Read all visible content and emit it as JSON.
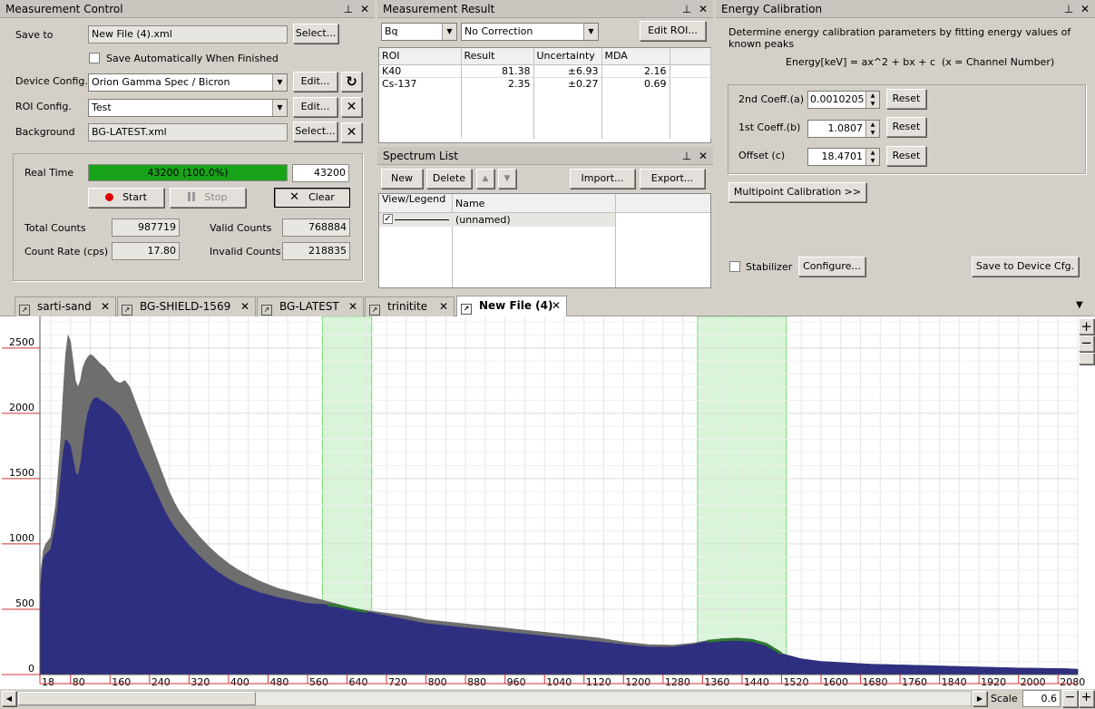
{
  "measurement_control": {
    "title": "Measurement Control",
    "save_to_label": "Save to",
    "save_to_value": "New File (4).xml",
    "select_label": "Select...",
    "auto_save_label": "Save Automatically When Finished",
    "device_config_label": "Device Config.",
    "device_config_value": "Orion Gamma Spec / Bicron",
    "edit_label": "Edit...",
    "roi_config_label": "ROI Config.",
    "roi_config_value": "Test",
    "background_label": "Background",
    "background_value": "BG-LATEST.xml",
    "real_time_label": "Real Time",
    "real_time_progress_text": "43200 (100.0%)",
    "real_time_progress": 1.0,
    "real_time_value": "43200",
    "start_label": "Start",
    "stop_label": "Stop",
    "clear_label": "Clear",
    "total_counts_label": "Total Counts",
    "total_counts_value": "987719",
    "valid_counts_label": "Valid Counts",
    "valid_counts_value": "768884",
    "count_rate_label": "Count Rate (cps)",
    "count_rate_value": "17.80",
    "invalid_counts_label": "Invalid Counts",
    "invalid_counts_value": "218835"
  },
  "measurement_result": {
    "title": "Measurement Result",
    "unit_value": "Bq",
    "correction_value": "No Correction",
    "edit_roi_label": "Edit ROI...",
    "columns": [
      "ROI",
      "Result",
      "Uncertainty",
      "MDA"
    ],
    "rows": [
      {
        "roi": "K40",
        "result": "81.38",
        "uncertainty": "±6.93",
        "mda": "2.16"
      },
      {
        "roi": "Cs-137",
        "result": "2.35",
        "uncertainty": "±0.27",
        "mda": "0.69"
      }
    ]
  },
  "spectrum_list": {
    "title": "Spectrum List",
    "new_label": "New",
    "delete_label": "Delete",
    "import_label": "Import...",
    "export_label": "Export...",
    "col_view": "View/Legend",
    "col_name": "Name",
    "row_name": "(unnamed)"
  },
  "energy_calibration": {
    "title": "Energy Calibration",
    "description": "Determine energy calibration parameters by fitting energy values of known peaks",
    "formula": "Energy[keV] = ax^2 + bx + c  (x = Channel Number)",
    "coeff_a_label": "2nd Coeff.(a)",
    "coeff_a_value": "0.0010205",
    "coeff_b_label": "1st Coeff.(b)",
    "coeff_b_value": "1.0807",
    "coeff_c_label": "Offset (c)",
    "coeff_c_value": "18.4701",
    "reset_label": "Reset",
    "multipoint_label": "Multipoint Calibration >>",
    "stabilizer_label": "Stabilizer",
    "configure_label": "Configure...",
    "save_device_label": "Save to Device Cfg."
  },
  "tabs": [
    {
      "label": "sarti-sand",
      "active": false
    },
    {
      "label": "BG-SHIELD-1569",
      "active": false
    },
    {
      "label": "BG-LATEST",
      "active": false
    },
    {
      "label": "trinitite",
      "active": false
    },
    {
      "label": "New File (4)",
      "active": true
    }
  ],
  "bottom_bar": {
    "scale_label": "Scale",
    "scale_value": "0.6"
  },
  "colors": {
    "spectrum_fill": "#2e2f80",
    "background_fill": "#6e6e6e",
    "roi_band": "#d8f5d8",
    "progress_green": "#19a319"
  },
  "chart_data": {
    "type": "area",
    "x_ticks": [
      "18",
      "80",
      "160",
      "240",
      "320",
      "400",
      "480",
      "560",
      "640",
      "720",
      "800",
      "880",
      "960",
      "1040",
      "1120",
      "1200",
      "1280",
      "1360",
      "1440",
      "1520",
      "1600",
      "1680",
      "1760",
      "1840",
      "1920",
      "2000",
      "2080"
    ],
    "y_ticks": [
      "0",
      "500",
      "1000",
      "1500",
      "2000",
      "2500"
    ],
    "ylim": [
      0,
      2700
    ],
    "xlim": [
      0,
      2120
    ],
    "roi_ranges": [
      [
        590,
        690
      ],
      [
        1350,
        1530
      ]
    ],
    "series": [
      {
        "x": [
          18,
          20,
          25,
          30,
          40,
          50,
          60,
          65,
          70,
          75,
          80,
          85,
          90,
          95,
          100,
          105,
          110,
          115,
          120,
          125,
          130,
          135,
          140,
          150,
          160,
          170,
          180,
          190,
          200,
          210,
          220,
          230,
          240,
          250,
          260,
          270,
          280,
          290,
          300,
          320,
          340,
          360,
          380,
          400,
          420,
          440,
          460,
          480,
          500,
          520,
          540,
          560,
          580,
          600,
          620,
          640,
          660,
          680,
          700,
          720,
          760,
          800,
          850,
          900,
          950,
          1000,
          1050,
          1100,
          1150,
          1200,
          1250,
          1300,
          1340,
          1370,
          1400,
          1430,
          1460,
          1490,
          1520,
          1560,
          1600,
          1650,
          1700,
          1800,
          1900,
          2000,
          2100,
          2120
        ],
        "values": [
          0,
          800,
          950,
          1000,
          1050,
          1300,
          1800,
          2150,
          2450,
          2600,
          2550,
          2400,
          2250,
          2200,
          2250,
          2350,
          2400,
          2430,
          2450,
          2440,
          2420,
          2400,
          2380,
          2350,
          2300,
          2250,
          2230,
          2250,
          2200,
          2100,
          2000,
          1900,
          1800,
          1700,
          1600,
          1500,
          1400,
          1320,
          1250,
          1150,
          1060,
          980,
          910,
          850,
          800,
          760,
          720,
          690,
          660,
          640,
          620,
          600,
          580,
          560,
          540,
          520,
          500,
          490,
          480,
          470,
          450,
          420,
          400,
          380,
          360,
          340,
          320,
          300,
          280,
          250,
          230,
          225,
          240,
          260,
          275,
          280,
          270,
          240,
          160,
          120,
          100,
          90,
          80,
          70,
          60,
          50,
          45,
          40
        ]
      },
      {
        "x": [
          18,
          20,
          25,
          30,
          40,
          50,
          60,
          65,
          70,
          75,
          80,
          85,
          90,
          95,
          100,
          105,
          110,
          115,
          120,
          125,
          130,
          135,
          140,
          150,
          160,
          170,
          180,
          190,
          200,
          210,
          220,
          230,
          240,
          250,
          260,
          270,
          280,
          290,
          300,
          320,
          340,
          360,
          380,
          400,
          420,
          440,
          460,
          480,
          500,
          520,
          540,
          560,
          580,
          600,
          620,
          640,
          660,
          680,
          700,
          720,
          760,
          800,
          850,
          900,
          950,
          1000,
          1050,
          1100,
          1150,
          1200,
          1250,
          1300,
          1340,
          1370,
          1400,
          1430,
          1460,
          1490,
          1520,
          1560,
          1600,
          1650,
          1700,
          1800,
          1900,
          2000,
          2100,
          2120
        ],
        "values": [
          0,
          700,
          880,
          920,
          960,
          1150,
          1500,
          1700,
          1800,
          1780,
          1750,
          1650,
          1550,
          1520,
          1600,
          1750,
          1900,
          2000,
          2060,
          2100,
          2120,
          2120,
          2100,
          2080,
          2050,
          2020,
          1980,
          1920,
          1850,
          1760,
          1670,
          1590,
          1510,
          1420,
          1340,
          1260,
          1190,
          1130,
          1080,
          990,
          910,
          840,
          780,
          730,
          690,
          660,
          630,
          610,
          590,
          575,
          560,
          545,
          540,
          535,
          525,
          510,
          495,
          480,
          465,
          450,
          420,
          390,
          370,
          350,
          330,
          310,
          290,
          270,
          250,
          230,
          210,
          210,
          230,
          255,
          265,
          270,
          262,
          230,
          160,
          120,
          100,
          90,
          80,
          70,
          60,
          50,
          45,
          40
        ]
      }
    ]
  }
}
